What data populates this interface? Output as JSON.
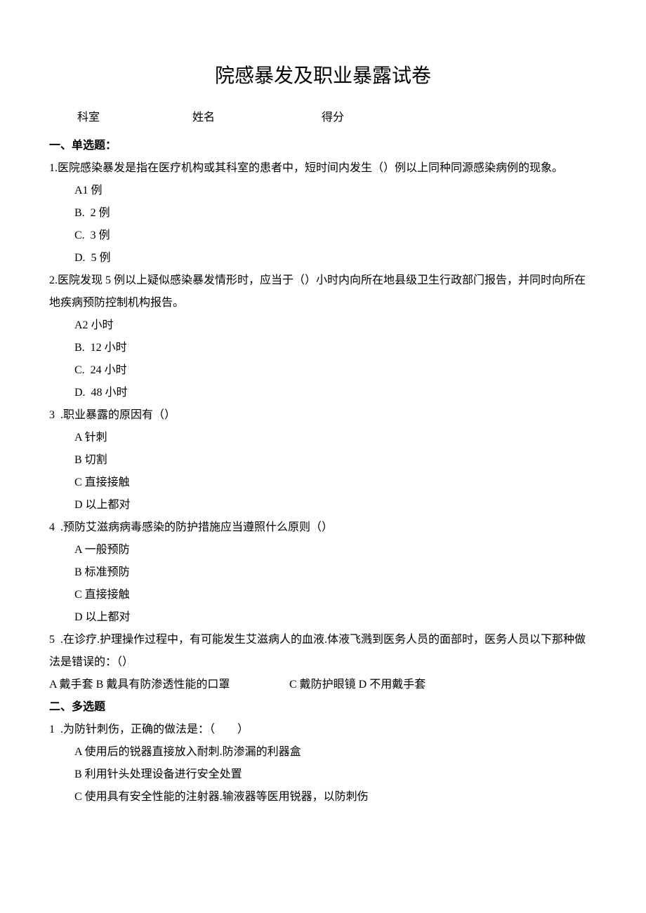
{
  "title": "院感暴发及职业暴露试卷",
  "info": {
    "dept": "科室",
    "name": "姓名",
    "score": "得分"
  },
  "section1": {
    "header": "一、单选题：",
    "q1": {
      "stem": "1.医院感染暴发是指在医疗机构或其科室的患者中，短时间内发生（）例以上同种同源感染病例的现象。",
      "a": "A1 例",
      "b": "B.  2 例",
      "c": "C.  3 例",
      "d": "D.  5 例"
    },
    "q2": {
      "line1": "2.医院发现 5 例以上疑似感染暴发情形时，应当于（）小时内向所在地县级卫生行政部门报告，并同时向所在",
      "line2": "地疾病预防控制机构报告。",
      "a": "A2 小时",
      "b": "B.  12 小时",
      "c": "C.  24 小时",
      "d": "D.  48 小时"
    },
    "q3": {
      "stem": "3  .职业暴露的原因有（）",
      "a": "A 针刺",
      "b": "B 切割",
      "c": "C 直接接触",
      "d": "D 以上都对"
    },
    "q4": {
      "stem": "4  .预防艾滋病病毒感染的防护措施应当遵照什么原则（）",
      "a": "A 一般预防",
      "b": "B 标准预防",
      "c": "C 直接接触",
      "d": "D 以上都对"
    },
    "q5": {
      "line1": "5  .在诊疗.护理操作过程中，有可能发生艾滋病人的血液.体液飞溅到医务人员的面部时，医务人员以下那种做",
      "line2": "法是错误的：（）",
      "ab": "A 戴手套 B 戴具有防渗透性能的口罩",
      "cd": "C 戴防护眼镜 D 不用戴手套"
    }
  },
  "section2": {
    "header": "二、多选题",
    "q1": {
      "stem": "1  .为防针刺伤，正确的做法是：（　　）",
      "a": "A 使用后的锐器直接放入耐刺.防渗漏的利器盒",
      "b": "B 利用针头处理设备进行安全处置",
      "c": "C 使用具有安全性能的注射器.输液器等医用锐器，以防刺伤"
    }
  }
}
